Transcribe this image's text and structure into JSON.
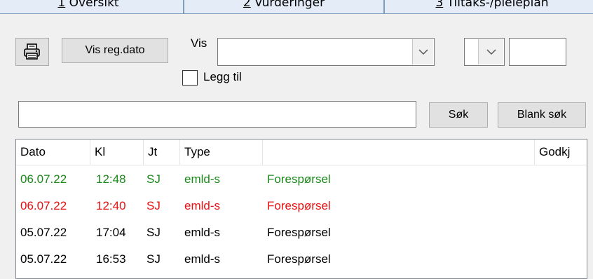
{
  "tabs": [
    {
      "number": "1",
      "label": " Oversikt"
    },
    {
      "number": "2",
      "label": " Vurderinger"
    },
    {
      "number": "3",
      "label": " Tiltaks-/pleieplan"
    }
  ],
  "toolbar": {
    "print_icon": "printer-icon",
    "vis_reg_dato_label": "Vis reg.dato",
    "vis_label": "Vis",
    "vis_value": "",
    "small_combo_value": "",
    "small_input_value": "",
    "legg_til_label": "Legg til",
    "legg_til_checked": false
  },
  "search": {
    "value": "",
    "sok_label": "Søk",
    "blank_sok_label": "Blank søk"
  },
  "list": {
    "columns": [
      "Dato",
      "Kl",
      "Jt",
      "Type",
      "",
      "Godkj"
    ],
    "rows": [
      {
        "dato": "06.07.22",
        "kl": "12:48",
        "jt": "SJ",
        "type": "emld-s",
        "desc": "Forespørsel",
        "color": "#1a8a1a"
      },
      {
        "dato": "06.07.22",
        "kl": "12:40",
        "jt": "SJ",
        "type": "emld-s",
        "desc": "Forespørsel",
        "color": "#e81010"
      },
      {
        "dato": "05.07.22",
        "kl": "17:04",
        "jt": "SJ",
        "type": "emld-s",
        "desc": "Forespørsel",
        "color": "#000000"
      },
      {
        "dato": "05.07.22",
        "kl": "16:53",
        "jt": "SJ",
        "type": "emld-s",
        "desc": "Forespørsel",
        "color": "#000000"
      }
    ]
  }
}
